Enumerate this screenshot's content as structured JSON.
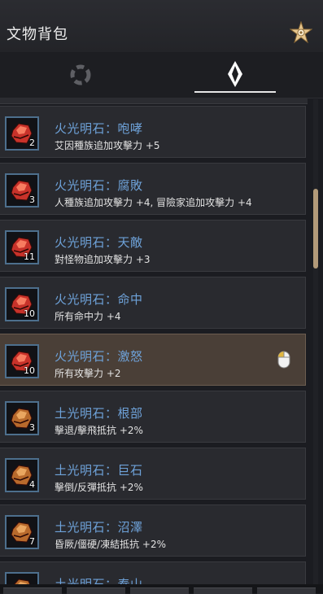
{
  "window": {
    "title": "文物背包",
    "settings_icon": "star-ornament-icon"
  },
  "tabs": [
    {
      "icon": "loading-ring-icon",
      "active": false
    },
    {
      "icon": "diamond-crystal-icon",
      "active": true
    }
  ],
  "colors": {
    "name": "#6ea2d9",
    "selected_row": "#4a3f37",
    "scroll_thumb": "#b29a79",
    "fire_gem": "#c8322a",
    "earth_gem": "#b86a2c"
  },
  "items": [
    {
      "name": "火光明石：咆哮",
      "effect": "艾因種族追加攻擊力 +5",
      "count": "2",
      "gem": "fire"
    },
    {
      "name": "火光明石：腐敗",
      "effect": "人種族追加攻擊力 +4, 冒險家追加攻擊力 +4",
      "count": "3",
      "gem": "fire"
    },
    {
      "name": "火光明石：天敵",
      "effect": "對怪物追加攻擊力 +3",
      "count": "11",
      "gem": "fire"
    },
    {
      "name": "火光明石：命中",
      "effect": "所有命中力 +4",
      "count": "10",
      "gem": "fire"
    },
    {
      "name": "火光明石：激怒",
      "effect": "所有攻擊力 +2",
      "count": "10",
      "gem": "fire",
      "selected": true
    },
    {
      "name": "土光明石：根部",
      "effect": "擊退/擊飛抵抗 +2%",
      "count": "3",
      "gem": "earth"
    },
    {
      "name": "土光明石：巨石",
      "effect": "擊倒/反彈抵抗 +2%",
      "count": "4",
      "gem": "earth"
    },
    {
      "name": "土光明石：沼澤",
      "effect": "昏厥/僵硬/凍結抵抗 +2%",
      "count": "7",
      "gem": "earth"
    },
    {
      "name": "土光明石：泰山",
      "effect": "",
      "count": "",
      "gem": "earth"
    }
  ]
}
